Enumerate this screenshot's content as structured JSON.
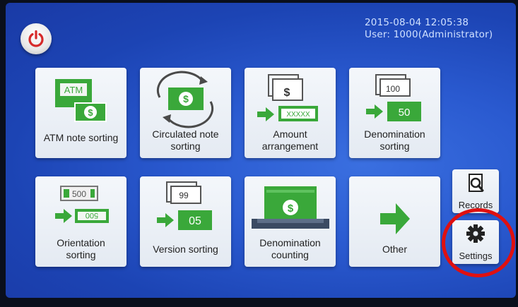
{
  "header": {
    "datetime": "2015-08-04   12:05:38",
    "user": "User: 1000(Administrator)"
  },
  "tiles": [
    {
      "label_line1": "ATM note sorting",
      "label_line2": "",
      "art_text": "ATM"
    },
    {
      "label_line1": "Circulated note",
      "label_line2": "sorting"
    },
    {
      "label_line1": "Amount",
      "label_line2": "arrangement",
      "art_text": "XXXXX"
    },
    {
      "label_line1": "Denomination",
      "label_line2": "sorting",
      "art_text_top": "100",
      "art_text_bottom": "50"
    },
    {
      "label_line1": "Orientation",
      "label_line2": "sorting",
      "art_text_top": "500",
      "art_text_bottom": "500"
    },
    {
      "label_line1": "Version sorting",
      "label_line2": "",
      "art_text_top": "99",
      "art_text_bottom": "05"
    },
    {
      "label_line1": "Denomination",
      "label_line2": "counting"
    },
    {
      "label_line1": "Other",
      "label_line2": ""
    }
  ],
  "side": {
    "records_label": "Records",
    "settings_label": "Settings"
  },
  "colors": {
    "accent_green": "#3aa83a",
    "highlight_ring": "#e01010"
  },
  "icons": {
    "power": "power-icon",
    "records": "magnifier-document-icon",
    "settings": "gear-icon"
  }
}
